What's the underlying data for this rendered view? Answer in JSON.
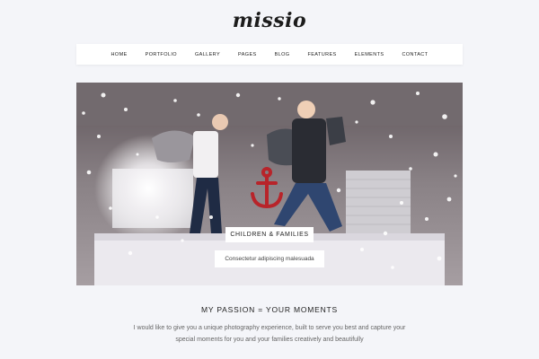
{
  "site": {
    "logo": "missio"
  },
  "nav": {
    "items": [
      "HOME",
      "PORTFOLIO",
      "GALLERY",
      "PAGES",
      "BLOG",
      "FEATURES",
      "ELEMENTS",
      "CONTACT"
    ]
  },
  "hero": {
    "caption_title": "CHILDREN & FAMILIES",
    "caption_subtitle": "Consectetur adipiscing malesuada"
  },
  "intro": {
    "title": "MY PASSION = YOUR MOMENTS",
    "body": "I would like to give you a unique photography experience, built to serve you best and capture your special moments for you and your families creatively and beautifully"
  },
  "colors": {
    "background": "#f4f5f9",
    "nav_bg": "#ffffff",
    "text": "#222222",
    "muted": "#666666"
  }
}
